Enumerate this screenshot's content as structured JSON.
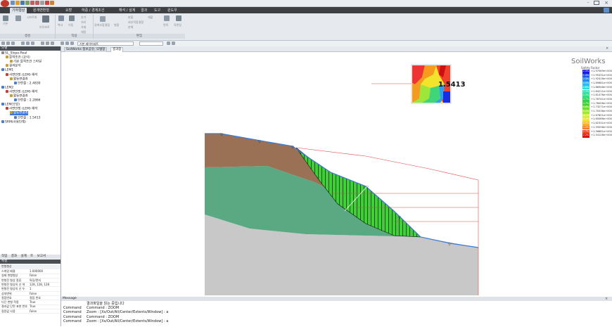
{
  "ribbon": {
    "menus": [
      "기하형상",
      "원개변환형",
      "요할",
      "하중 / 경계조건",
      "해석 / 설계",
      "결과",
      "도구",
      "윈도우"
    ],
    "active_menu": 0,
    "groups": [
      "생성",
      "작용",
      "",
      "",
      "편집"
    ],
    "buttons": [
      "기본",
      "시프트화",
      "미아보로",
      "복사",
      "이동",
      "추가",
      "처리",
      "삭제",
      "재정",
      "경계조합결합",
      "병합",
      "분할",
      "외부적합결합",
      "분해",
      "재할",
      "면적",
      "육면장"
    ],
    "combo": "기본 레이어세트"
  },
  "left_panel": {
    "head": "모델",
    "tree": [
      {
        "label": "SL_Slope-Real",
        "indent": 0,
        "color": "#888888"
      },
      {
        "label": "물적조건 (교식)",
        "indent": 1,
        "color": "#c8a030"
      },
      {
        "label": "기본 물적조건 스타일",
        "indent": 2,
        "color": "#c8a030"
      },
      {
        "label": "결과분석",
        "indent": 1,
        "color": "#c8a030"
      },
      {
        "label": "LEM1",
        "indent": 0,
        "color": "#4a7fc8"
      },
      {
        "label": "사면안정 (LEM) 해석",
        "indent": 1,
        "color": "#c04040"
      },
      {
        "label": "활동면결과",
        "indent": 2,
        "color": "#c8a030"
      },
      {
        "label": "안전율 : 2.4830",
        "indent": 3,
        "color": "#4a7fc8"
      },
      {
        "label": "LEM2",
        "indent": 0,
        "color": "#4a7fc8"
      },
      {
        "label": "사면안정 (LEM) 해석",
        "indent": 1,
        "color": "#c04040"
      },
      {
        "label": "활동면결과",
        "indent": 2,
        "color": "#c8a030"
      },
      {
        "label": "안전율 : 2.2866",
        "indent": 3,
        "color": "#4a7fc8"
      },
      {
        "label": "LEM(보강)",
        "indent": 0,
        "color": "#4a7fc8"
      },
      {
        "label": "사면안정 (LEM) 해석",
        "indent": 1,
        "color": "#c04040"
      },
      {
        "label": "활동면결과",
        "indent": 2,
        "color": "#c8a030",
        "selected": true
      },
      {
        "label": "안전율 : 1.5413",
        "indent": 3,
        "color": "#4a7fc8"
      },
      {
        "label": "SRM(사용단계)",
        "indent": 0,
        "color": "#4a7fc8"
      }
    ],
    "tabs": [
      "작업",
      "결과",
      "설계",
      "트",
      "보고서"
    ],
    "prop_head": "속성",
    "prop_group": "변형형상",
    "props": [
      {
        "k": "스케일 배율",
        "v": "1.000000"
      },
      {
        "k": "실제 변형형상",
        "v": "False"
      },
      {
        "k": "변형전 형상 종류",
        "v": "특징/면지"
      },
      {
        "k": "변형전 형상의 선 색",
        "v": "128, 128, 128"
      },
      {
        "k": "변형전 형상의 선 두",
        "v": "1"
      },
      {
        "k": "상대변위",
        "v": "False"
      },
      {
        "k": "절점번호",
        "v": "절점 번호"
      },
      {
        "k": "다단 변형 적용",
        "v": "True"
      },
      {
        "k": "결과값 단면 표현 번호",
        "v": "True"
      },
      {
        "k": "질량값 사용",
        "v": "False"
      }
    ]
  },
  "doc_tabs": [
    "SoilWorks 정보공유",
    "모델창",
    "결과창"
  ],
  "active_doc_tab": 2,
  "legend": {
    "brand": "SoilWorks",
    "title": "Safety Factor",
    "rows": [
      {
        "pct": "2.5%",
        "val": "+1.97069e+000",
        "color": "#1a1ae0"
      },
      {
        "pct": "1.4%",
        "val": "+1.95331e+000",
        "color": "#2456e8"
      },
      {
        "pct": "2.5%",
        "val": "+1.92416e+000",
        "color": "#2a8af0"
      },
      {
        "pct": "2.5%",
        "val": "+1.89681e+000",
        "color": "#30b8f0"
      },
      {
        "pct": "2.6%",
        "val": "+1.86946e+000",
        "color": "#30d8e0"
      },
      {
        "pct": "2.1%",
        "val": "+1.84211e+000",
        "color": "#30e0b0"
      },
      {
        "pct": "2.1%",
        "val": "+1.81476e+000",
        "color": "#30e080"
      },
      {
        "pct": "4.7%",
        "val": "+1.78741e+000",
        "color": "#30d050"
      },
      {
        "pct": "4.7%",
        "val": "+1.76006e+000",
        "color": "#40d030"
      },
      {
        "pct": "9.6%",
        "val": "+1.73271e+000",
        "color": "#70e030"
      },
      {
        "pct": "8.5%",
        "val": "+1.70536e+000",
        "color": "#a0e830"
      },
      {
        "pct": "10.3%",
        "val": "+1.67801e+000",
        "color": "#d0f030"
      },
      {
        "pct": "12.6%",
        "val": "+1.65066e+000",
        "color": "#f0e030"
      },
      {
        "pct": "6.9%",
        "val": "+1.62331e+000",
        "color": "#f8b028"
      },
      {
        "pct": "4.0%",
        "val": "+1.59596e+000",
        "color": "#f87820"
      },
      {
        "pct": "2.7%",
        "val": "+1.56861e+000",
        "color": "#f04018"
      },
      {
        "pct": "2.2%",
        "val": "+1.54126e+000",
        "color": "#e01010"
      }
    ]
  },
  "fs_value": "1.5413",
  "messages": {
    "head": "Message",
    "rows": [
      {
        "c": "",
        "t": "결과파일을 읽는 중입니다"
      },
      {
        "c": "Command",
        "t": "Command : ZOOM"
      },
      {
        "c": "Command",
        "t": "Zoom : [Xs/Out/All/Center/Extents/Window] : a"
      },
      {
        "c": "Command",
        "t": "Command : ZOOM"
      },
      {
        "c": "Command",
        "t": "Zoom : [Xs/Out/All/Center/Extents/Window] : a"
      }
    ]
  }
}
